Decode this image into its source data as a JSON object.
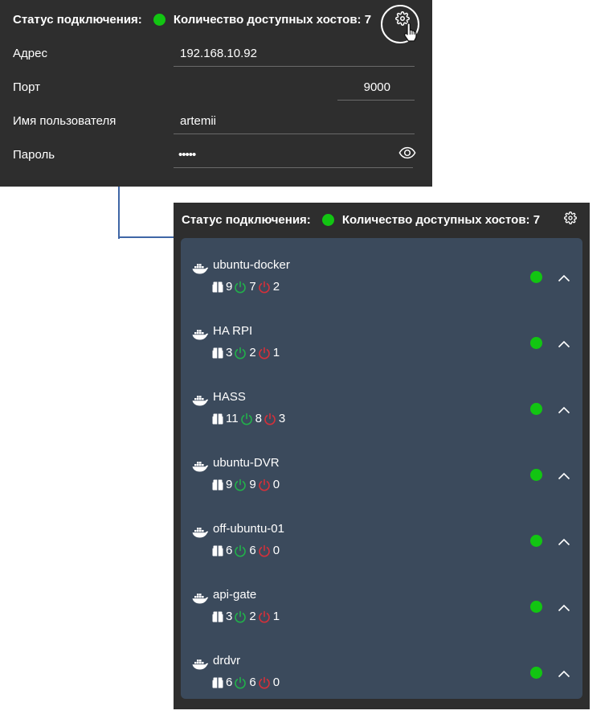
{
  "settings": {
    "status_label": "Статус подключения:",
    "hosts_count_label": "Количество доступных хостов: 7",
    "fields": {
      "address": {
        "label": "Адрес",
        "value": "192.168.10.92"
      },
      "port": {
        "label": "Порт",
        "value": "9000"
      },
      "username": {
        "label": "Имя пользователя",
        "value": "artemii"
      },
      "password": {
        "label": "Пароль",
        "value": "•••••"
      }
    }
  },
  "hosts_panel": {
    "status_label": "Статус подключения:",
    "hosts_count_label": "Количество доступных хостов: 7",
    "hosts": [
      {
        "name": "ubuntu-docker",
        "total": "9",
        "running": "7",
        "stopped": "2"
      },
      {
        "name": "HA RPI",
        "total": "3",
        "running": "2",
        "stopped": "1"
      },
      {
        "name": "HASS",
        "total": "11",
        "running": "8",
        "stopped": "3"
      },
      {
        "name": "ubuntu-DVR",
        "total": "9",
        "running": "9",
        "stopped": "0"
      },
      {
        "name": "off-ubuntu-01",
        "total": "6",
        "running": "6",
        "stopped": "0"
      },
      {
        "name": "api-gate",
        "total": "3",
        "running": "2",
        "stopped": "1"
      },
      {
        "name": "drdvr",
        "total": "6",
        "running": "6",
        "stopped": "0"
      }
    ]
  },
  "colors": {
    "panel_bg": "#2e2e2e",
    "list_bg": "#3b4a5c",
    "online": "#12c512",
    "running": "#22b04a",
    "stopped": "#d4303a",
    "connector": "#3f66a6"
  },
  "icons": [
    "gear-icon",
    "pointer-cursor-icon",
    "eye-icon",
    "docker-icon",
    "box-icon",
    "power-icon",
    "chevron-up-icon"
  ]
}
